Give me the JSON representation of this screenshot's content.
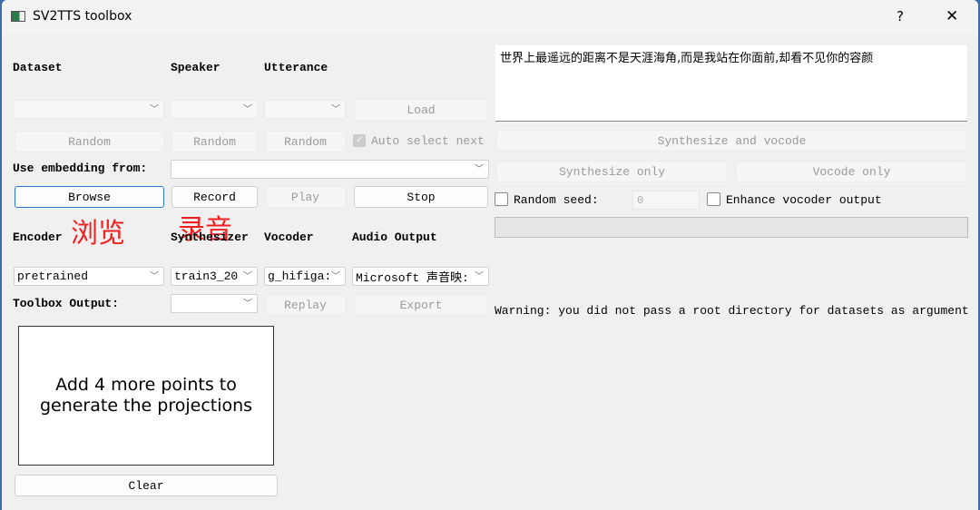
{
  "window": {
    "title": "SV2TTS toolbox",
    "help": "?",
    "close": "✕"
  },
  "labels": {
    "dataset": "Dataset",
    "speaker": "Speaker",
    "utterance": "Utterance",
    "use_embedding": "Use embedding from:",
    "encoder": "Encoder",
    "synthesizer": "Synthesizer",
    "vocoder": "Vocoder",
    "audio_output": "Audio Output",
    "toolbox_output": "Toolbox Output:"
  },
  "buttons": {
    "load": "Load",
    "random": "Random",
    "browse": "Browse",
    "record": "Record",
    "play": "Play",
    "stop": "Stop",
    "replay": "Replay",
    "export": "Export",
    "clear": "Clear",
    "synth_vocode": "Synthesize and vocode",
    "synth_only": "Synthesize only",
    "vocode_only": "Vocode only"
  },
  "checkboxes": {
    "auto_select": "Auto select next",
    "random_seed": "Random seed:",
    "enhance": "Enhance vocoder output"
  },
  "combos": {
    "encoder": "pretrained",
    "synthesizer": "train3_20",
    "vocoder": "g_hifiga:",
    "audio_output": "Microsoft 声音映:"
  },
  "seed_value": "0",
  "annotations": {
    "browse": "浏览",
    "record": "录音"
  },
  "text_input": "世界上最遥远的距离不是天涯海角,而是我站在你面前,却看不见你的容颜",
  "projection_message": "Add 4 more points to generate the projections",
  "warning": "Warning: you did not pass a root directory for datasets as argument"
}
